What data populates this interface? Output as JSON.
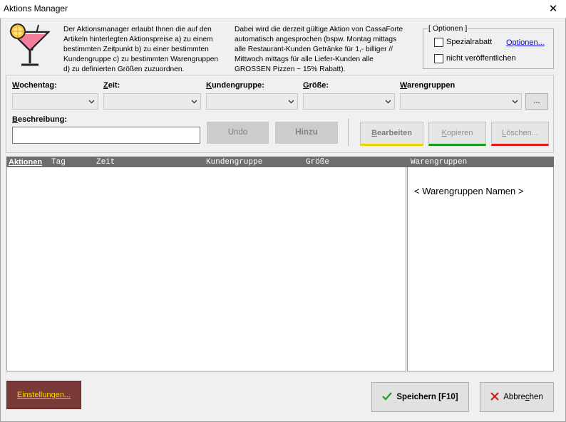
{
  "window": {
    "title": "Aktions Manager"
  },
  "intro": {
    "left_lines": [
      "Der Aktionsmanager erlaubt Ihnen die auf den",
      "Artikeln hinterlegten Aktionspreise a) zu einem",
      "bestimmten Zeitpunkt b) zu einer bestimmten",
      "Kundengruppe c) zu bestimmten Warengruppen",
      "d) zu definierten Größen zuzuordnen."
    ],
    "right_lines": [
      "Dabei wird die derzeit gültige Aktion von CassaForte",
      "automatisch angesprochen (bspw. Montag mittags",
      "alle Restaurant-Kunden Getränke für 1,- billiger //",
      "Mittwoch mittags für alle Liefer-Kunden alle",
      "GROSSEN Pizzen ~ 15% Rabatt)."
    ]
  },
  "options": {
    "legend": "[ Optionen ]",
    "spezialrabatt_label": "Spezialrabatt",
    "spezialrabatt_checked": false,
    "nicht_veroeffentlichen_label": "nicht veröffentlichen",
    "nicht_veroeffentlichen_checked": false,
    "optionen_link": "Optionen..."
  },
  "filters": {
    "wochentag": {
      "label_first": "W",
      "label_rest": "ochentag:",
      "value": ""
    },
    "zeit": {
      "label_first": "Z",
      "label_rest": "eit:",
      "value": ""
    },
    "kundengruppe": {
      "label_first": "K",
      "label_rest": "undengruppe:",
      "value": ""
    },
    "groesse": {
      "label_first": "G",
      "label_rest": "röße:",
      "value": ""
    },
    "warengruppen": {
      "label_first": "W",
      "label_rest": "arengruppen",
      "value": ""
    },
    "dots_button": "...",
    "beschreibung": {
      "label_first": "B",
      "label_rest": "eschreibung:",
      "value": ""
    }
  },
  "actions": {
    "undo": "Undo",
    "hinzu": "Hinzu",
    "bearbeiten_first": "B",
    "bearbeiten_rest": "earbeiten",
    "kopieren_first": "K",
    "kopieren_rest": "opieren",
    "loeschen_first": "L",
    "loeschen_rest": "öschen..."
  },
  "grid": {
    "columns": {
      "aktionen": "Aktionen",
      "tag": "Tag",
      "zeit": "Zeit",
      "kundengruppe": "Kundengruppe",
      "groesse": "Größe",
      "warengruppen": "Warengruppen"
    },
    "rows": [],
    "warengruppen_placeholder": "< Warengruppen Namen >"
  },
  "footer": {
    "einstellungen_first": "E",
    "einstellungen_rest": "instellungen...",
    "speichern": "Speichern [F10]",
    "abbrechen_pre": "Abbre",
    "abbrechen_u": "c",
    "abbrechen_post": "hen"
  },
  "colors": {
    "einstellungen_bg": "#7b3a3a",
    "einstellungen_text": "#ffd400",
    "bearbeiten_accent": "#e8d800",
    "kopieren_accent": "#1a9a1a",
    "loeschen_accent": "#e11a1a",
    "grid_header_bg": "#6d6d6d"
  },
  "icons": {
    "close": "close-icon",
    "cocktail": "cocktail-icon",
    "dropdown": "chevron-down-icon",
    "save": "checkmark-icon",
    "cancel": "cross-icon"
  }
}
